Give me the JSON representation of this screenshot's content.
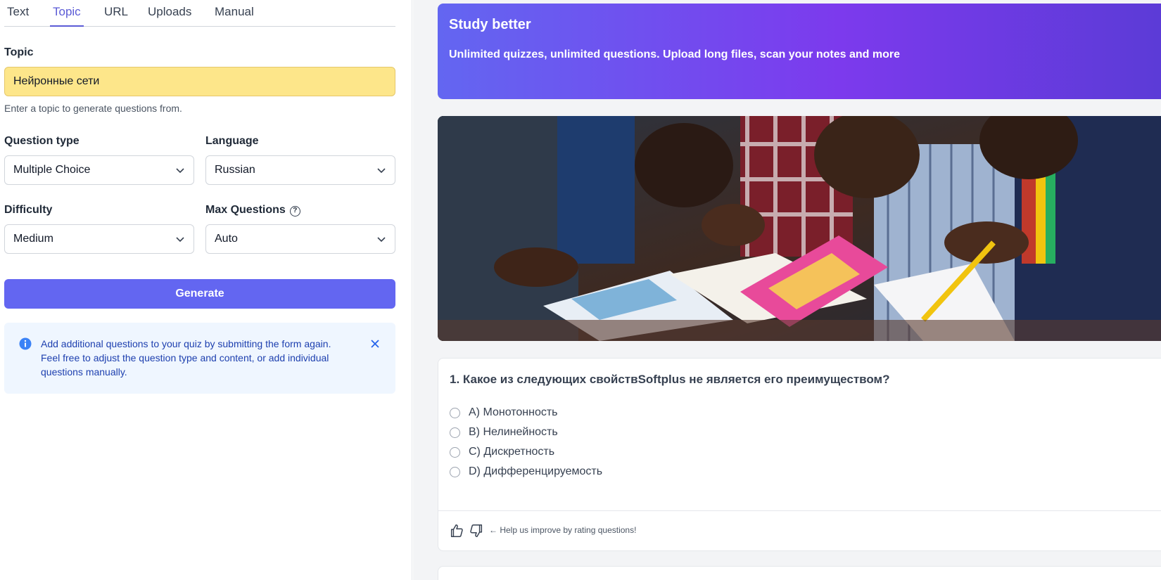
{
  "tabs": [
    "Text",
    "Topic",
    "URL",
    "Uploads",
    "Manual"
  ],
  "topic": {
    "label": "Topic",
    "value": "Нейронные сети",
    "help": "Enter a topic to generate questions from."
  },
  "question_type": {
    "label": "Question type",
    "value": "Multiple Choice"
  },
  "language": {
    "label": "Language",
    "value": "Russian"
  },
  "difficulty": {
    "label": "Difficulty",
    "value": "Medium"
  },
  "max_questions": {
    "label": "Max Questions",
    "value": "Auto"
  },
  "generate_label": "Generate",
  "alert_text": "Add additional questions to your quiz by submitting the form again. Feel free to adjust the question type and content, or add individual questions manually.",
  "banner": {
    "title": "Study better",
    "subtitle": "Unlimited quizzes, unlimited questions. Upload long files, scan your notes and more"
  },
  "question": {
    "title": "1. Какое из следующих свойствSoftplus не является его преимуществом?",
    "options": [
      "A) Монотонность",
      "B) Нелинейность",
      "C) Дискретность",
      "D) Дифференцируемость"
    ],
    "rating_hint": "← Help us improve by rating questions!"
  },
  "colors": {
    "accent": "#6366f1",
    "topic_highlight": "#fde68a",
    "alert_bg": "#eff6ff",
    "alert_text": "#1e40af"
  },
  "icons": [
    "chevron-down-icon",
    "help-circle-icon",
    "info-icon",
    "close-icon",
    "thumbs-up-icon",
    "thumbs-down-icon"
  ]
}
